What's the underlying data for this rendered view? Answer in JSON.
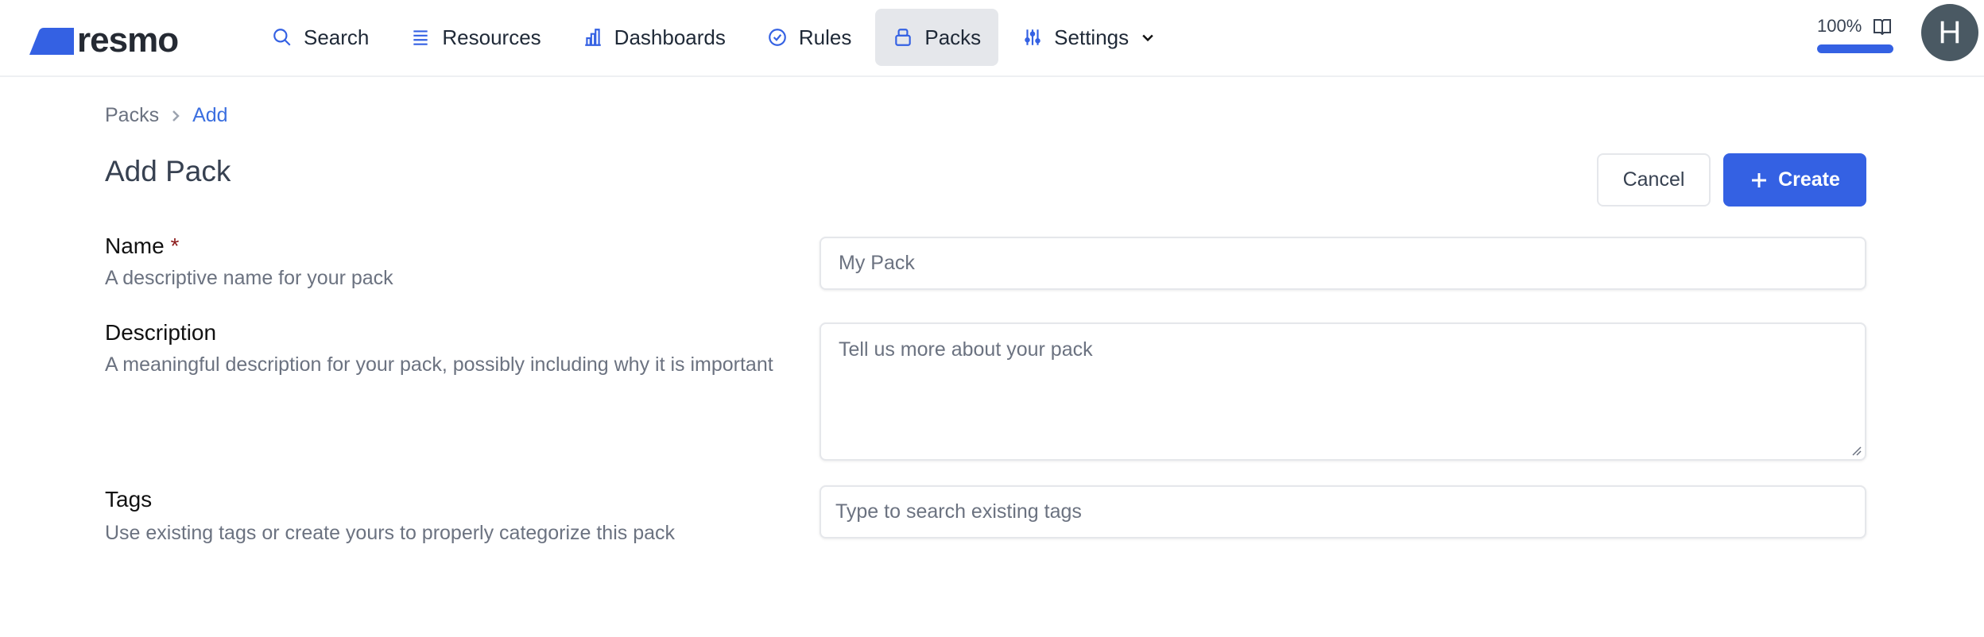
{
  "header": {
    "logo_text": "resmo",
    "nav": [
      {
        "label": "Search",
        "icon": "search-icon"
      },
      {
        "label": "Resources",
        "icon": "list-icon"
      },
      {
        "label": "Dashboards",
        "icon": "bar-chart-icon"
      },
      {
        "label": "Rules",
        "icon": "badge-check-icon"
      },
      {
        "label": "Packs",
        "icon": "pack-icon",
        "active": true
      },
      {
        "label": "Settings",
        "icon": "sliders-icon"
      }
    ],
    "progress": {
      "label": "100%",
      "value": 100
    },
    "avatar_initial": "H"
  },
  "breadcrumb": {
    "parent": "Packs",
    "current": "Add"
  },
  "page": {
    "title": "Add Pack",
    "cancel_label": "Cancel",
    "create_label": "Create"
  },
  "form": {
    "name": {
      "label": "Name",
      "required_mark": "*",
      "help": "A descriptive name for your pack",
      "placeholder": "My Pack"
    },
    "description": {
      "label": "Description",
      "help": "A meaningful description for your pack, possibly including why it is important",
      "placeholder": "Tell us more about your pack"
    },
    "tags": {
      "label": "Tags",
      "help": "Use existing tags or create yours to properly categorize this pack",
      "placeholder": "Type to search existing tags"
    }
  },
  "colors": {
    "accent": "#3461e3",
    "avatar": "#4a5963"
  }
}
